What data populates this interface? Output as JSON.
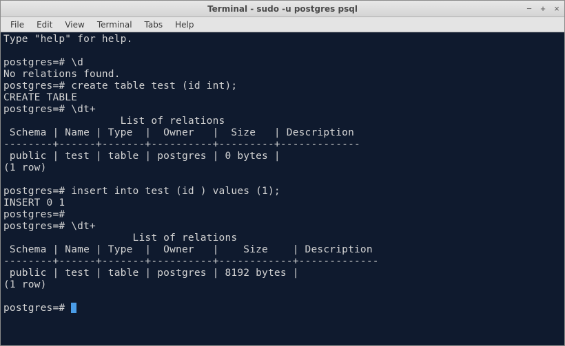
{
  "window": {
    "title": "Terminal - sudo -u postgres psql"
  },
  "menu": {
    "file": "File",
    "edit": "Edit",
    "view": "View",
    "terminal": "Terminal",
    "tabs": "Tabs",
    "help": "Help"
  },
  "terminal": {
    "line01": "Type \"help\" for help.",
    "line02": "",
    "line03": "postgres=# \\d",
    "line04": "No relations found.",
    "line05": "postgres=# create table test (id int);",
    "line06": "CREATE TABLE",
    "line07": "postgres=# \\dt+",
    "line08": "                   List of relations",
    "line09": " Schema | Name | Type  |  Owner   |  Size   | Description ",
    "line10": "--------+------+-------+----------+---------+-------------",
    "line11": " public | test | table | postgres | 0 bytes | ",
    "line12": "(1 row)",
    "line13": "",
    "line14": "postgres=# insert into test (id ) values (1);",
    "line15": "INSERT 0 1",
    "line16": "postgres=# ",
    "line17": "postgres=# \\dt+",
    "line18": "                     List of relations",
    "line19": " Schema | Name | Type  |  Owner   |    Size    | Description ",
    "line20": "--------+------+-------+----------+------------+-------------",
    "line21": " public | test | table | postgres | 8192 bytes | ",
    "line22": "(1 row)",
    "line23": "",
    "line24": "postgres=# "
  }
}
